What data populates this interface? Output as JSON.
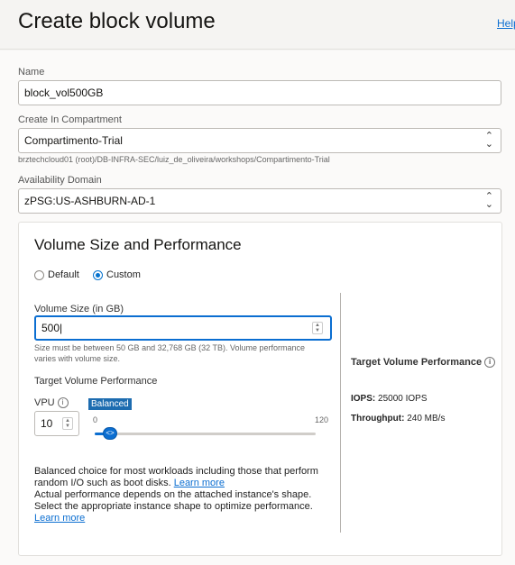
{
  "header": {
    "title": "Create block volume",
    "help_label": "Help"
  },
  "form": {
    "name": {
      "label": "Name",
      "value": "block_vol500GB"
    },
    "compartment": {
      "label": "Create In Compartment",
      "value": "Compartimento-Trial",
      "path": "brztechcloud01 (root)/DB-INFRA-SEC/luiz_de_oliveira/workshops/Compartimento-Trial"
    },
    "availability_domain": {
      "label": "Availability Domain",
      "value": "zPSG:US-ASHBURN-AD-1"
    }
  },
  "volume": {
    "title": "Volume Size and Performance",
    "options": [
      {
        "label": "Default",
        "selected": false
      },
      {
        "label": "Custom",
        "selected": true
      }
    ],
    "size_label": "Volume Size (in GB)",
    "size_value": "500",
    "size_hint": "Size must be between 50 GB and 32,768 GB (32 TB). Volume performance varies with volume size.",
    "perf_label": "Target Volume Performance",
    "vpu_label": "VPU",
    "vpu_value": "10",
    "slider_badge": "Balanced",
    "slider_min": "0",
    "slider_max": "120",
    "slider_level_fraction": 0.0833,
    "description_1": "Balanced choice for most workloads including those that perform random I/O such as boot disks.",
    "learn_more": "Learn more",
    "description_2": "Actual performance depends on the attached instance's shape. Select the appropriate instance shape to optimize performance.",
    "learn_more_2": "Learn more"
  },
  "target": {
    "title": "Target Volume Performance",
    "iops_label": "IOPS:",
    "iops_value": "25000 IOPS",
    "throughput_label": "Throughput:",
    "throughput_value": "240 MB/s"
  },
  "colors": {
    "accent": "#0b6ed1",
    "badge": "#1d6cb0"
  }
}
